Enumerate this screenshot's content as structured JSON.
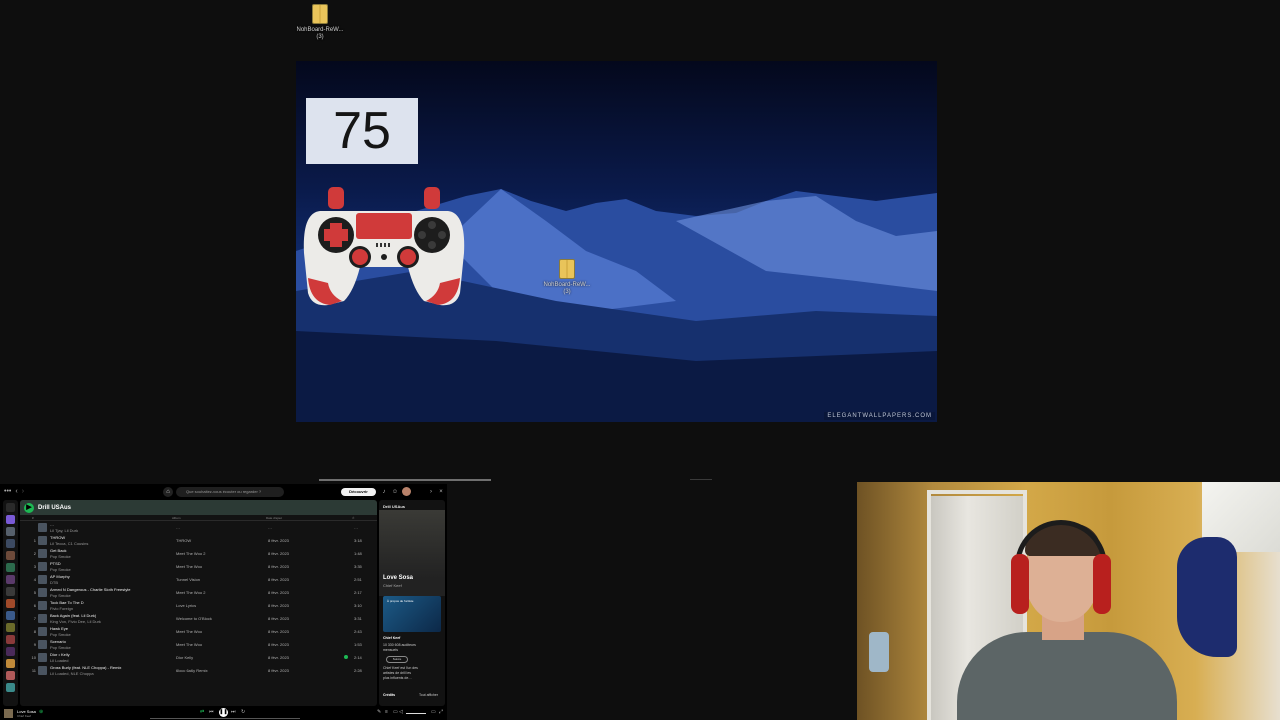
{
  "desktop_top_icon": {
    "label_line1": "NohBoard-ReW...",
    "label_line2": "(3)"
  },
  "desktop": {
    "score": "75",
    "icon": {
      "label_line1": "NohBoard-ReW...",
      "label_line2": "(3)"
    },
    "watermark": "ELEGANTWALLPAPERS.COM"
  },
  "spotify": {
    "search_placeholder": "Que souhaitez-vous écouter ou regarder ?",
    "premium_label": "Découvrir Premium",
    "playlist_title": "Drill USAus",
    "columns": {
      "num": "#",
      "title": "Titre",
      "album": "Album",
      "date": "Date d'ajout",
      "duration": "⏱"
    },
    "rows": [
      {
        "num": "",
        "title": "…",
        "artist": "Lil Tjay, Lil Durk",
        "album": "…",
        "date": "…",
        "dur": "…"
      },
      {
        "num": "1",
        "title": "THROW",
        "artist": "Lil Tecca, C1 Cousins",
        "album": "THROW",
        "date": "8 févr. 2023",
        "dur": "3:18"
      },
      {
        "num": "2",
        "title": "Get Back",
        "artist": "Pop Smoke",
        "album": "Meet The Woo 2",
        "date": "8 févr. 2023",
        "dur": "1:48"
      },
      {
        "num": "3",
        "title": "PTSD",
        "artist": "Pop Smoke",
        "album": "Meet The Woo",
        "date": "8 févr. 2023",
        "dur": "3:35"
      },
      {
        "num": "4",
        "title": "AP Murphy",
        "artist": "DTB",
        "album": "Tunnel Vision",
        "date": "8 févr. 2023",
        "dur": "2:51"
      },
      {
        "num": "5",
        "title": "Armed N Dangerous - Charlie Sloth Freestyle",
        "artist": "Pop Smoke",
        "album": "Meet The Woo 2",
        "date": "8 févr. 2023",
        "dur": "2:17"
      },
      {
        "num": "6",
        "title": "Tock Bae To The D",
        "artist": "Fivio Foreign",
        "album": "Love Lyrics",
        "date": "8 févr. 2023",
        "dur": "3:10"
      },
      {
        "num": "7",
        "title": "Back Again (feat. Lil Durk)",
        "artist": "King Von, Fivio Dee, Lil Durk",
        "album": "Welcome to O'Block",
        "date": "8 févr. 2023",
        "dur": "3:31"
      },
      {
        "num": "8",
        "title": "Hawk Eye",
        "artist": "Pop Smoke",
        "album": "Meet The Woo",
        "date": "8 févr. 2023",
        "dur": "2:43"
      },
      {
        "num": "9",
        "title": "Scenario",
        "artist": "Pop Smoke",
        "album": "Meet The Woo",
        "date": "8 févr. 2023",
        "dur": "1:53"
      },
      {
        "num": "10",
        "title": "Dior • Kelly",
        "artist": "Lil Loaded",
        "album": "Dior Kelly",
        "date": "8 févr. 2023",
        "dur": "2:14",
        "liked": true
      },
      {
        "num": "11",
        "title": "Gross Burly (feat. NLE Choppa) - Remix",
        "artist": "Lil Loaded, NLE Choppa",
        "album": "6locc 6a6y Remix",
        "date": "8 févr. 2023",
        "dur": "2:28"
      }
    ],
    "right_panel": {
      "header": "Drill USAus",
      "song": "Love Sosa",
      "artist": "Chief Keef",
      "card_label": "À propos de l'artiste",
      "about_artist": "Chief Keef",
      "listeners": "10 330 608 auditeurs",
      "listeners_sub": "mensuels",
      "follow": "Suivre",
      "bio_line1": "Chief Keef est l'un des",
      "bio_line2": "artistes de drill les",
      "bio_line3": "plus influents de…",
      "credits": "Crédits",
      "show_all": "Tout afficher"
    },
    "player": {
      "now_playing_title": "Love Sosa",
      "now_playing_artist": "Chief Keef"
    }
  }
}
